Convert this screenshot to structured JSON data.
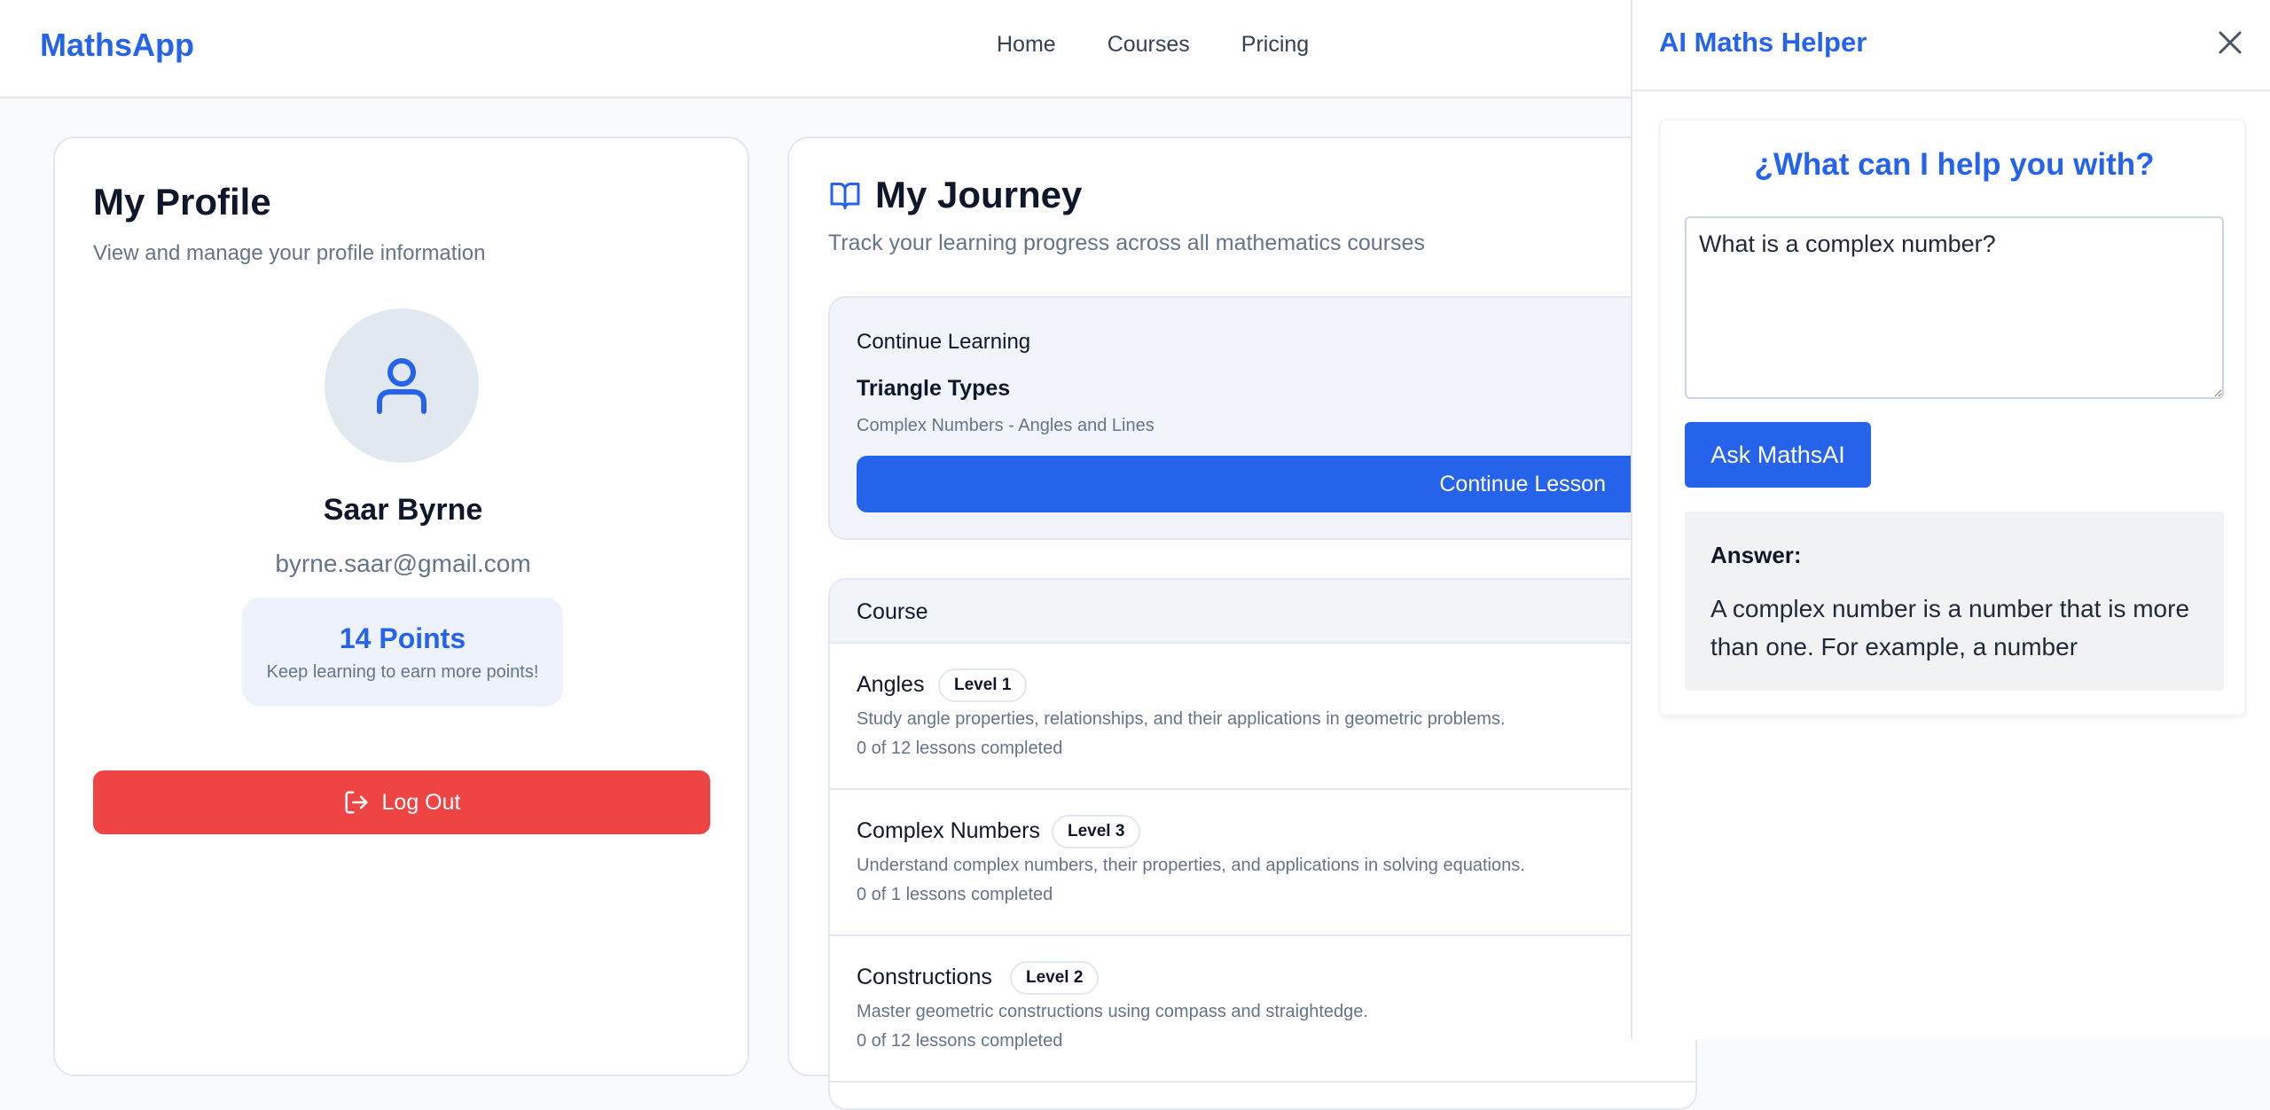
{
  "header": {
    "logo": "MathsApp",
    "nav": [
      "Home",
      "Courses",
      "Pricing"
    ]
  },
  "profile": {
    "title": "My Profile",
    "subtitle": "View and manage your profile information",
    "name": "Saar Byrne",
    "email": "byrne.saar@gmail.com",
    "points": "14 Points",
    "points_hint": "Keep learning to earn more points!",
    "logout": "Log Out"
  },
  "journey": {
    "title": "My Journey",
    "subtitle": "Track your learning progress across all mathematics courses",
    "continue": {
      "heading": "Continue Learning",
      "lesson": "Triangle Types",
      "context": "Complex Numbers - Angles and Lines",
      "button": "Continue Lesson"
    },
    "courses_header": "Course",
    "courses": [
      {
        "name": "Angles",
        "level": "Level 1",
        "desc": "Study angle properties, relationships, and their applications in geometric problems.",
        "progress": "0 of 12 lessons completed"
      },
      {
        "name": "Complex Numbers",
        "level": "Level 3",
        "desc": "Understand complex numbers, their properties, and applications in solving equations.",
        "progress": "0 of 1 lessons completed"
      },
      {
        "name": "Constructions",
        "level": "Level 2",
        "desc": "Master geometric constructions using compass and straightedge.",
        "progress": "0 of 12 lessons completed"
      }
    ]
  },
  "ai": {
    "title": "AI Maths Helper",
    "question": "¿What can I help you with?",
    "input_value": "What is a complex number?",
    "ask_button": "Ask MathsAI",
    "answer_label": "Answer:",
    "answer_text": "A complex number is a number that is more than one. For example, a number"
  },
  "colors": {
    "accent": "#2563eb",
    "danger": "#ef4444"
  }
}
